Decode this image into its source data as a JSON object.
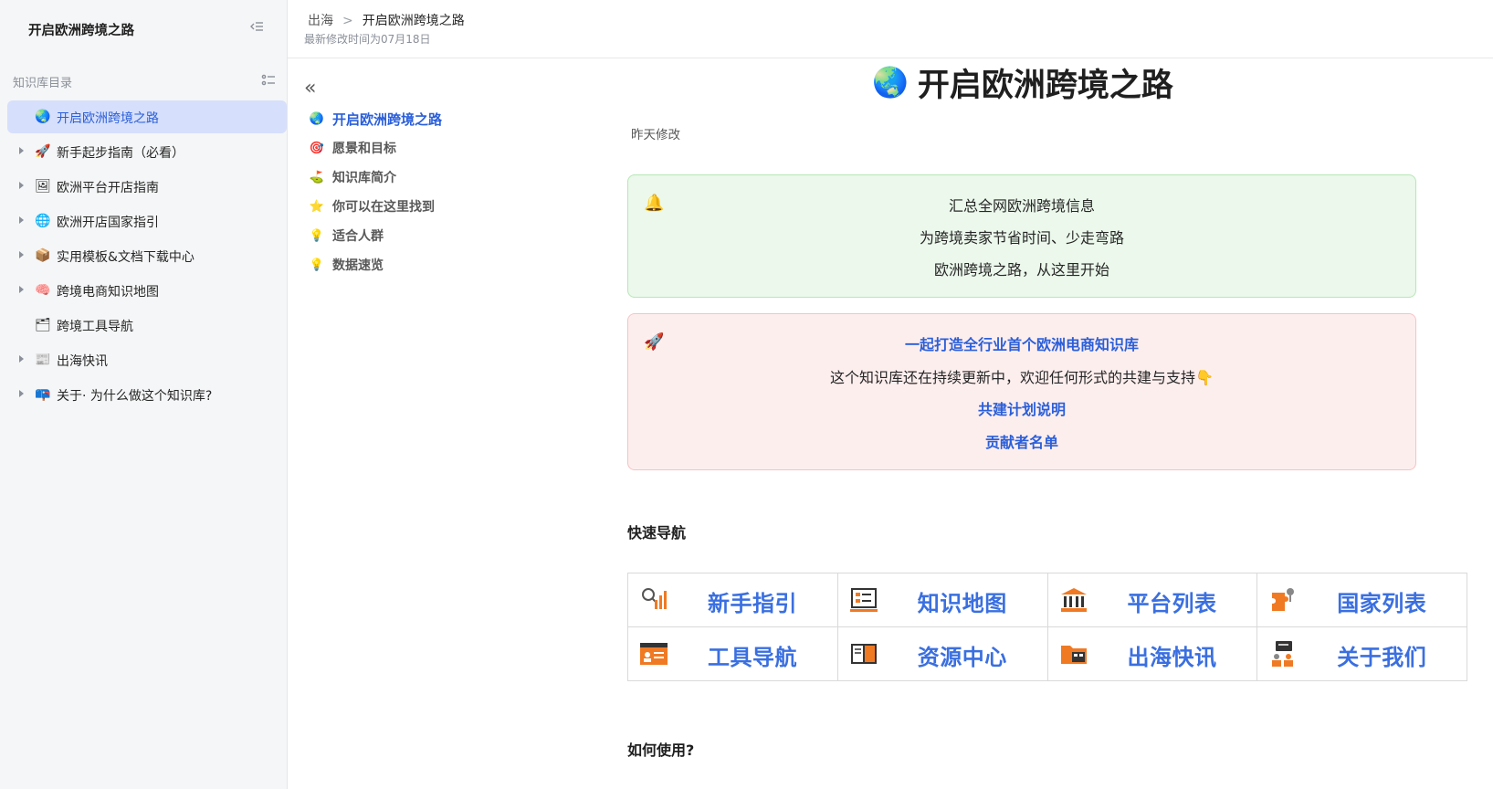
{
  "sidebar": {
    "title": "开启欧洲跨境之路",
    "section_label": "知识库目录",
    "items": [
      {
        "icon": "🌏",
        "label": "开启欧洲跨境之路"
      },
      {
        "icon": "🚀",
        "label": "新手起步指南（必看）"
      },
      {
        "icon": "🖼",
        "label": "欧洲平台开店指南"
      },
      {
        "icon": "🌐",
        "label": "欧洲开店国家指引"
      },
      {
        "icon": "📦",
        "label": "实用模板&文档下载中心"
      },
      {
        "icon": "🧠",
        "label": "跨境电商知识地图"
      },
      {
        "icon": "🗂",
        "label": "跨境工具导航"
      },
      {
        "icon": "📰",
        "label": "出海快讯"
      },
      {
        "icon": "📪",
        "label": "关于· 为什么做这个知识库?"
      }
    ]
  },
  "header": {
    "breadcrumb_parent": "出海",
    "breadcrumb_separator": ">",
    "breadcrumb_current": "开启欧洲跨境之路",
    "modified": "最新修改时间为07月18日"
  },
  "toc": {
    "back": "«",
    "items": [
      {
        "icon": "🌏",
        "label": "开启欧洲跨境之路"
      },
      {
        "icon": "🎯",
        "label": "愿景和目标"
      },
      {
        "icon": "⛳",
        "label": "知识库简介"
      },
      {
        "icon": "⭐",
        "label": "你可以在这里找到"
      },
      {
        "icon": "💡",
        "label": "适合人群"
      },
      {
        "icon": "💡",
        "label": "数据速览"
      }
    ]
  },
  "doc": {
    "title_icon": "🌏",
    "title": "开启欧洲跨境之路",
    "meta": "昨天修改",
    "callout_green": {
      "icon": "🔔",
      "lines": [
        "汇总全网欧洲跨境信息",
        "为跨境卖家节省时间、少走弯路",
        "欧洲跨境之路，从这里开始"
      ]
    },
    "callout_red": {
      "icon": "🚀",
      "headline": "一起打造全行业首个欧洲电商知识库",
      "text": "这个知识库还在持续更新中，欢迎任何形式的共建与支持👇",
      "link1": "共建计划说明",
      "link2": "贡献者名单"
    },
    "quick_nav_heading": "快速导航",
    "quick_nav": [
      {
        "icon": "magnifier-chart-icon",
        "label": "新手指引"
      },
      {
        "icon": "presentation-board-icon",
        "label": "知识地图"
      },
      {
        "icon": "bank-building-icon",
        "label": "平台列表"
      },
      {
        "icon": "map-pin-icon",
        "label": "国家列表"
      },
      {
        "icon": "browser-window-icon",
        "label": "工具导航"
      },
      {
        "icon": "open-book-icon",
        "label": "资源中心"
      },
      {
        "icon": "folder-icon",
        "label": "出海快讯"
      },
      {
        "icon": "chat-people-icon",
        "label": "关于我们"
      }
    ],
    "how_to_use_heading": "如何使用?"
  },
  "colors": {
    "accent": "#2b5fd9",
    "nav_link": "#3a6fe0",
    "icon_orange": "#f07a24",
    "active_bg": "#d6dffb"
  }
}
